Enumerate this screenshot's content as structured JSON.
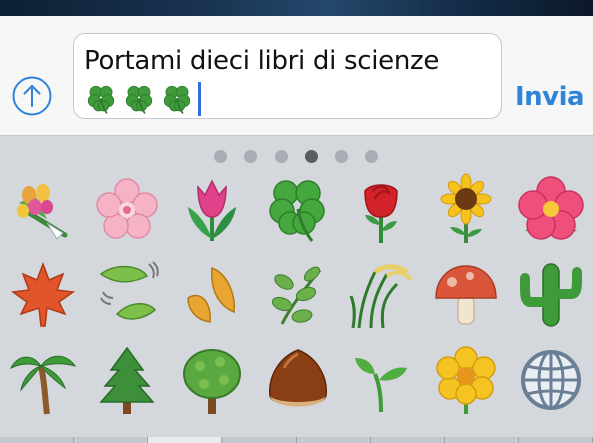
{
  "compose": {
    "attach_icon": "arrow-up-circle-icon",
    "message_text": "Portami dieci libri di scienze",
    "trailing_emoji": [
      "four-leaf-clover",
      "four-leaf-clover",
      "four-leaf-clover"
    ],
    "send_label": "Invia",
    "accent_color": "#2e84d8"
  },
  "emoji_keyboard": {
    "page_count": 6,
    "active_page": 4,
    "emoji": [
      [
        "bouquet",
        "cherry-blossom",
        "tulip",
        "four-leaf-clover",
        "rose",
        "sunflower",
        "hibiscus"
      ],
      [
        "maple-leaf",
        "leaf-fluttering-in-wind",
        "fallen-leaf",
        "herb",
        "ear-of-rice",
        "mushroom",
        "cactus"
      ],
      [
        "palm-tree",
        "evergreen-tree",
        "deciduous-tree",
        "chestnut",
        "seedling",
        "blossom",
        "globe-with-meridians"
      ]
    ]
  }
}
